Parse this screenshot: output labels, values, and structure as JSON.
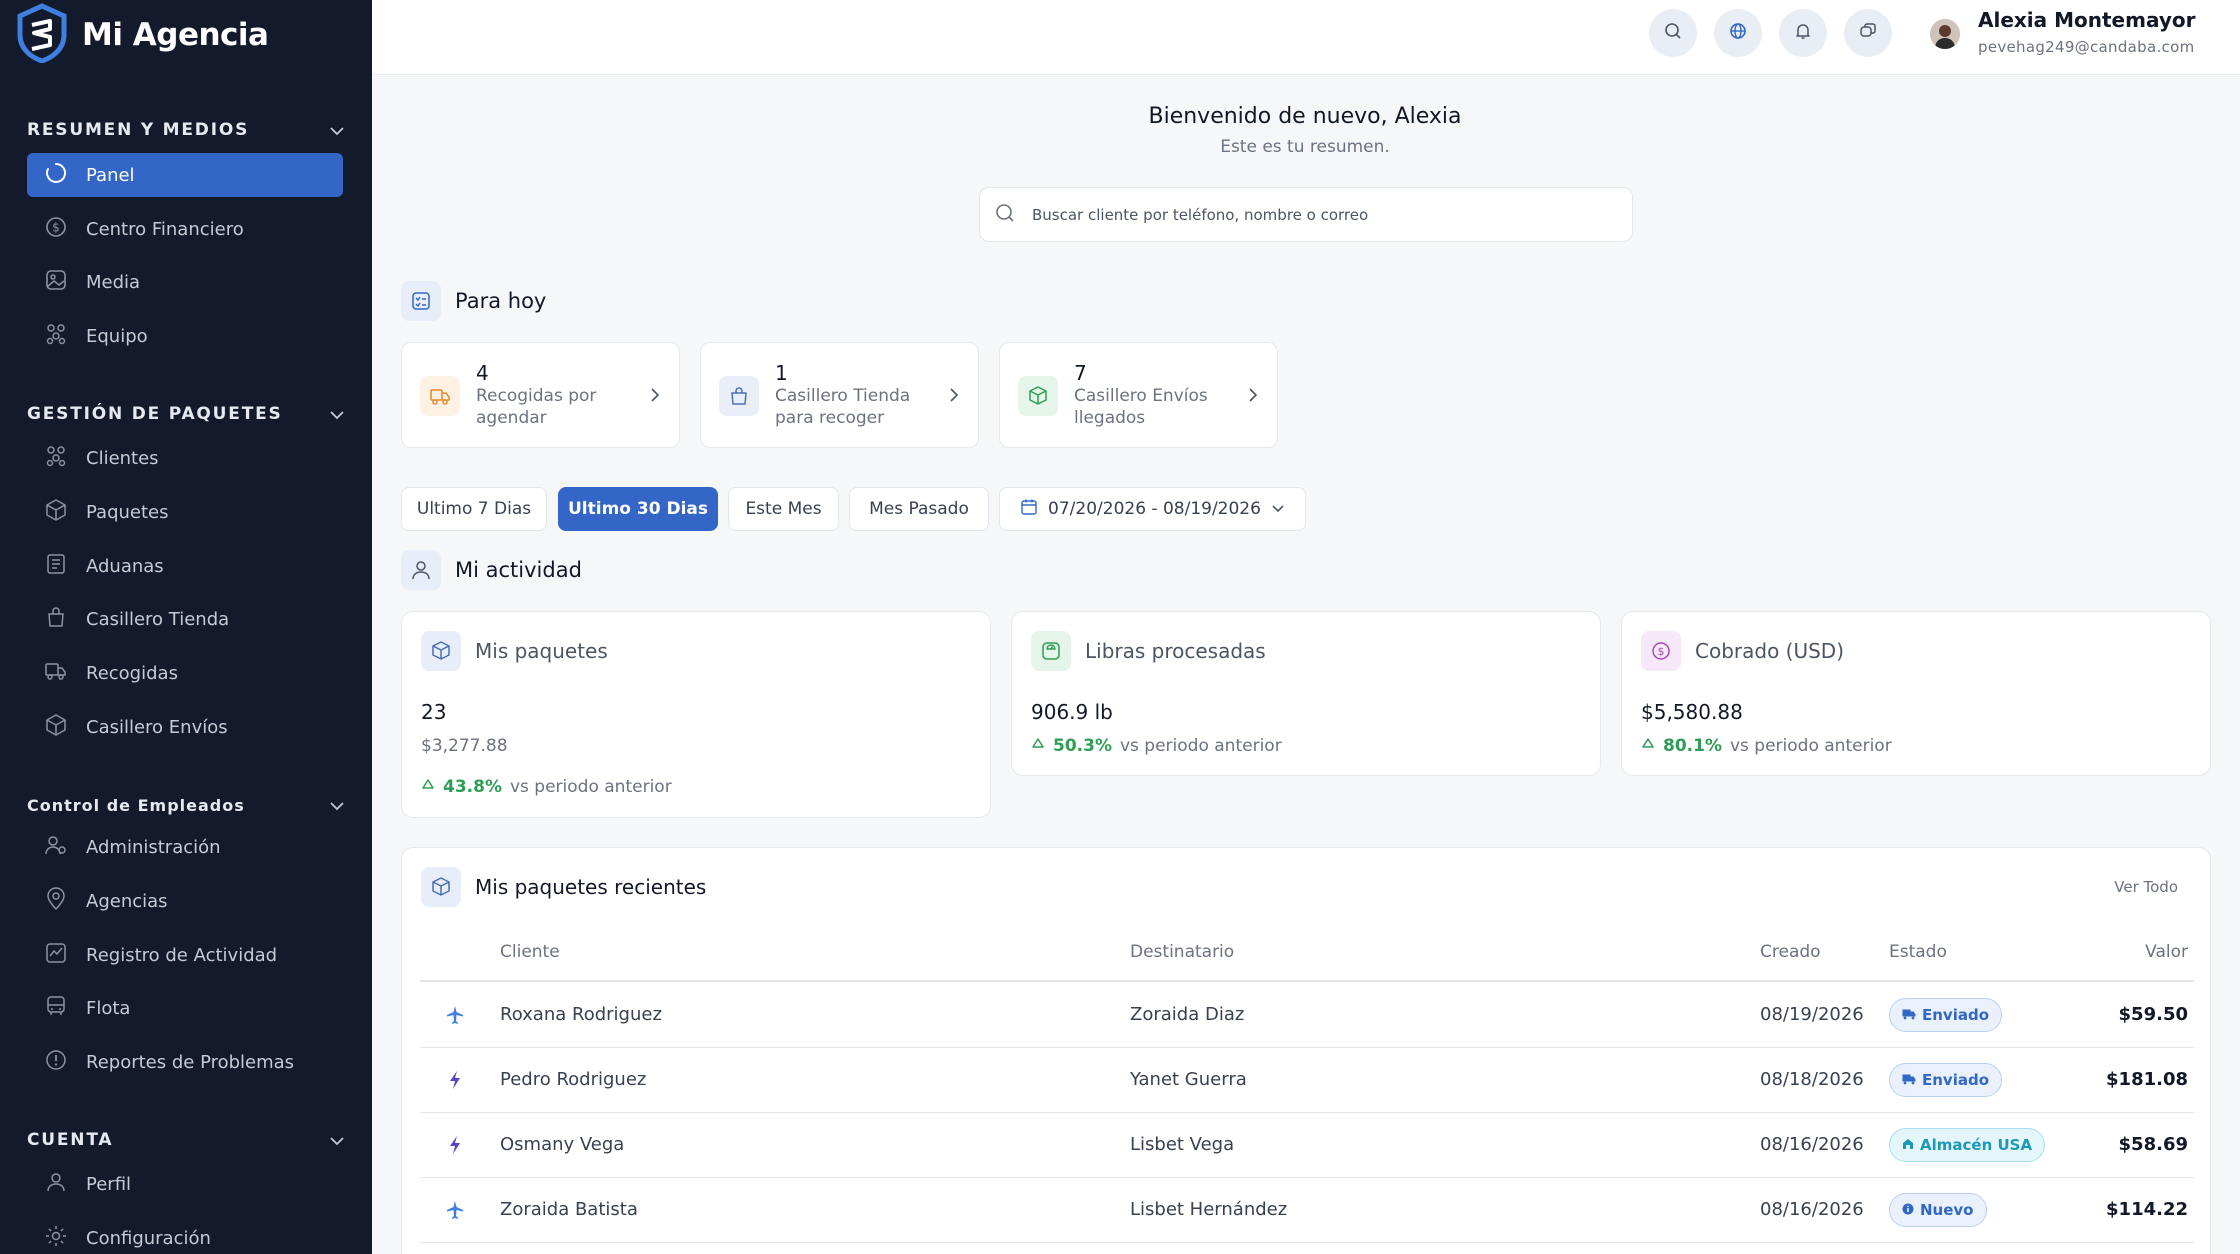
{
  "app": {
    "brand": "Mi Agencia"
  },
  "sidebar": {
    "sections": [
      {
        "title": "RESUMEN Y MEDIOS",
        "items": [
          {
            "label": "Panel",
            "icon": "spinner-icon"
          },
          {
            "label": "Centro Financiero",
            "icon": "dollar-circle-icon"
          },
          {
            "label": "Media",
            "icon": "image-icon"
          },
          {
            "label": "Equipo",
            "icon": "team-icon"
          }
        ]
      },
      {
        "title": "GESTIÓN DE PAQUETES",
        "items": [
          {
            "label": "Clientes",
            "icon": "clients-icon"
          },
          {
            "label": "Paquetes",
            "icon": "box-icon"
          },
          {
            "label": "Aduanas",
            "icon": "document-icon"
          },
          {
            "label": "Casillero Tienda",
            "icon": "bag-icon"
          },
          {
            "label": "Recogidas",
            "icon": "truck-icon"
          },
          {
            "label": "Casillero Envíos",
            "icon": "package-icon"
          }
        ]
      },
      {
        "title": "Control de Empleados",
        "items": [
          {
            "label": "Administración",
            "icon": "users-gear-icon"
          },
          {
            "label": "Agencias",
            "icon": "location-pin-icon"
          },
          {
            "label": "Registro de Actividad",
            "icon": "activity-chart-icon"
          },
          {
            "label": "Flota",
            "icon": "bus-icon"
          },
          {
            "label": "Reportes de Problemas",
            "icon": "alert-circle-icon"
          }
        ]
      },
      {
        "title": "CUENTA",
        "items": [
          {
            "label": "Perfil",
            "icon": "user-icon"
          },
          {
            "label": "Configuración",
            "icon": "gear-icon"
          }
        ]
      }
    ]
  },
  "user": {
    "name": "Alexia Montemayor",
    "email": "pevehag249@candaba.com"
  },
  "welcome": {
    "title": "Bienvenido de nuevo, Alexia",
    "subtitle": "Este es tu resumen."
  },
  "search": {
    "placeholder": "Buscar cliente por teléfono, nombre o correo"
  },
  "today": {
    "title": "Para hoy",
    "cards": [
      {
        "count": "4",
        "label": "Recogidas por agendar"
      },
      {
        "count": "1",
        "label": "Casillero Tienda para recoger"
      },
      {
        "count": "7",
        "label": "Casillero Envíos llegados"
      }
    ]
  },
  "filters": {
    "options": [
      "Ultimo 7 Dias",
      "Ultimo 30 Dias",
      "Este Mes",
      "Mes Pasado"
    ],
    "selected": "Ultimo 30 Dias",
    "date_range": "07/20/2026 - 08/19/2026"
  },
  "activity": {
    "title": "Mi actividad",
    "cards": [
      {
        "title": "Mis paquetes",
        "value": "23",
        "sub": "$3,277.88",
        "pct": "43.8%",
        "trend_text": "vs periodo anterior"
      },
      {
        "title": "Libras procesadas",
        "value": "906.9 lb",
        "pct": "50.3%",
        "trend_text": "vs periodo anterior"
      },
      {
        "title": "Cobrado (USD)",
        "value": "$5,580.88",
        "pct": "80.1%",
        "trend_text": "vs periodo anterior"
      }
    ]
  },
  "recent": {
    "title": "Mis paquetes recientes",
    "view_all": "Ver Todo",
    "columns": [
      "Cliente",
      "Destinatario",
      "Creado",
      "Estado",
      "Valor"
    ],
    "rows": [
      {
        "type_icon": "airplane-icon",
        "cliente": "Roxana Rodriguez",
        "destinatario": "Zoraida Diaz",
        "creado": "08/19/2026",
        "estado": "Enviado",
        "valor": "$59.50"
      },
      {
        "type_icon": "lightning-icon",
        "cliente": "Pedro Rodriguez",
        "destinatario": "Yanet Guerra",
        "creado": "08/18/2026",
        "estado": "Enviado",
        "valor": "$181.08"
      },
      {
        "type_icon": "lightning-icon",
        "cliente": "Osmany Vega",
        "destinatario": "Lisbet Vega",
        "creado": "08/16/2026",
        "estado": "Almacén USA",
        "valor": "$58.69"
      },
      {
        "type_icon": "airplane-icon",
        "cliente": "Zoraida Batista",
        "destinatario": "Lisbet Hernández",
        "creado": "08/16/2026",
        "estado": "Nuevo",
        "valor": "$114.22"
      }
    ]
  },
  "colors": {
    "sidebar_bg": "#131a2c",
    "accent": "#3366c6",
    "positive": "#2e9d55"
  }
}
